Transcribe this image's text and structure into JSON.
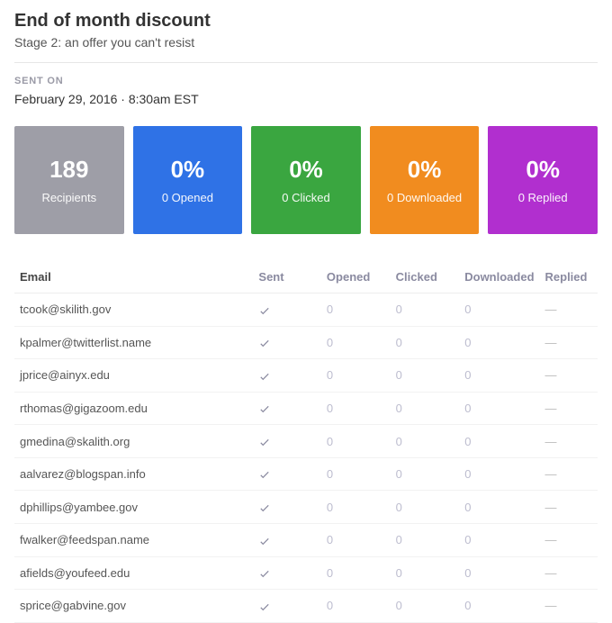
{
  "header": {
    "title": "End of month discount",
    "subtitle": "Stage 2: an offer you can't resist"
  },
  "sent_on": {
    "label": "SENT ON",
    "value": "February 29, 2016 · 8:30am EST"
  },
  "cards": {
    "recipients": {
      "value": "189",
      "label": "Recipients",
      "color": "#9e9ea7"
    },
    "opened": {
      "value": "0%",
      "label": "0 Opened",
      "color": "#2f72e6"
    },
    "clicked": {
      "value": "0%",
      "label": "0 Clicked",
      "color": "#3aa640"
    },
    "downloaded": {
      "value": "0%",
      "label": "0 Downloaded",
      "color": "#f18c1f"
    },
    "replied": {
      "value": "0%",
      "label": "0 Replied",
      "color": "#b12fcf"
    }
  },
  "table": {
    "headers": {
      "email": "Email",
      "sent": "Sent",
      "opened": "Opened",
      "clicked": "Clicked",
      "downloaded": "Downloaded",
      "replied": "Replied"
    },
    "rows": [
      {
        "email": "tcook@skilith.gov",
        "sent": true,
        "opened": "0",
        "clicked": "0",
        "downloaded": "0",
        "replied": "—"
      },
      {
        "email": "kpalmer@twitterlist.name",
        "sent": true,
        "opened": "0",
        "clicked": "0",
        "downloaded": "0",
        "replied": "—"
      },
      {
        "email": "jprice@ainyx.edu",
        "sent": true,
        "opened": "0",
        "clicked": "0",
        "downloaded": "0",
        "replied": "—"
      },
      {
        "email": "rthomas@gigazoom.edu",
        "sent": true,
        "opened": "0",
        "clicked": "0",
        "downloaded": "0",
        "replied": "—"
      },
      {
        "email": "gmedina@skalith.org",
        "sent": true,
        "opened": "0",
        "clicked": "0",
        "downloaded": "0",
        "replied": "—"
      },
      {
        "email": "aalvarez@blogspan.info",
        "sent": true,
        "opened": "0",
        "clicked": "0",
        "downloaded": "0",
        "replied": "—"
      },
      {
        "email": "dphillips@yambee.gov",
        "sent": true,
        "opened": "0",
        "clicked": "0",
        "downloaded": "0",
        "replied": "—"
      },
      {
        "email": "fwalker@feedspan.name",
        "sent": true,
        "opened": "0",
        "clicked": "0",
        "downloaded": "0",
        "replied": "—"
      },
      {
        "email": "afields@youfeed.edu",
        "sent": true,
        "opened": "0",
        "clicked": "0",
        "downloaded": "0",
        "replied": "—"
      },
      {
        "email": "sprice@gabvine.gov",
        "sent": true,
        "opened": "0",
        "clicked": "0",
        "downloaded": "0",
        "replied": "—"
      }
    ]
  }
}
